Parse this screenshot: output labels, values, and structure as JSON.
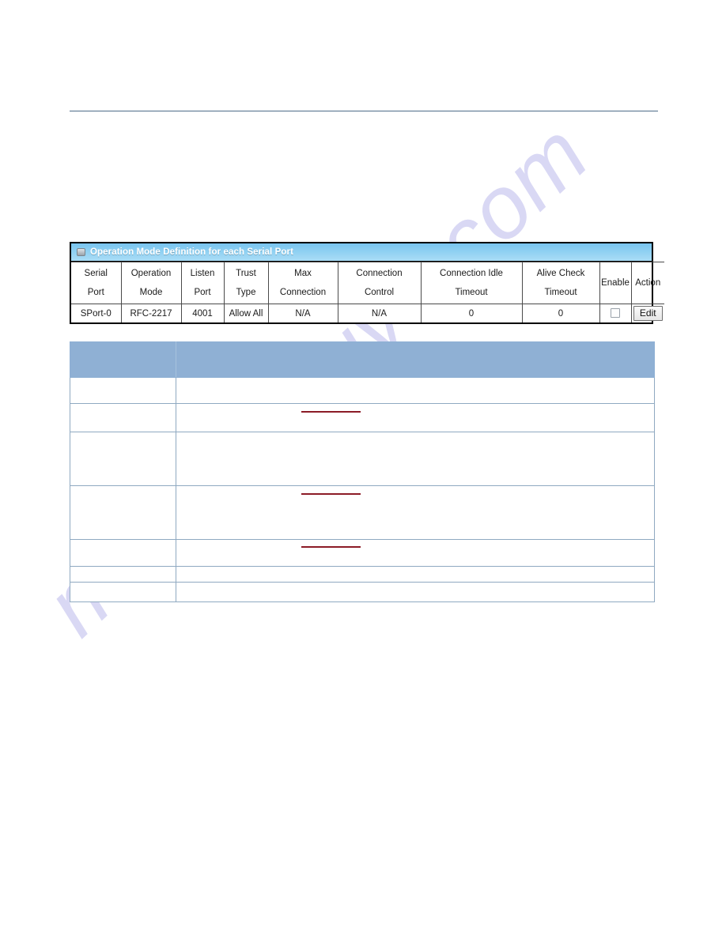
{
  "page": {
    "watermark": "manualshive.com",
    "accent_blue": "#8fb0d4",
    "title_blue": "#8fd0f2",
    "rule_color": "#4d6c88",
    "marker_red": "#8c1b26"
  },
  "panel": {
    "icon": "monitor-icon",
    "title": "Operation Mode Definition for each Serial Port",
    "columns": [
      {
        "line1": "Serial",
        "line2": "Port"
      },
      {
        "line1": "Operation",
        "line2": "Mode"
      },
      {
        "line1": "Listen",
        "line2": "Port"
      },
      {
        "line1": "Trust",
        "line2": "Type"
      },
      {
        "line1": "Max",
        "line2": "Connection"
      },
      {
        "line1": "Connection",
        "line2": "Control"
      },
      {
        "line1": "Connection Idle",
        "line2": "Timeout"
      },
      {
        "line1": "Alive Check",
        "line2": "Timeout"
      },
      {
        "line1": "Enable",
        "line2": ""
      },
      {
        "line1": "Action",
        "line2": ""
      }
    ],
    "rows": [
      {
        "serial_port": "SPort-0",
        "operation_mode": "RFC-2217",
        "listen_port": "4001",
        "trust_type": "Allow All",
        "max_connection": "N/A",
        "connection_control": "N/A",
        "connection_idle_timeout": "0",
        "alive_check_timeout": "0",
        "enable_checked": false,
        "action_label": "Edit"
      }
    ]
  },
  "description_table": {
    "header": {
      "col1": "",
      "col2": ""
    },
    "rows": [
      {
        "col1": "",
        "col2": ""
      },
      {
        "col1": "",
        "col2": ""
      },
      {
        "col1": "",
        "col2": ""
      },
      {
        "col1": "",
        "col2": ""
      },
      {
        "col1": "",
        "col2": ""
      },
      {
        "col1": "",
        "col2": ""
      },
      {
        "col1": "",
        "col2": ""
      }
    ]
  }
}
